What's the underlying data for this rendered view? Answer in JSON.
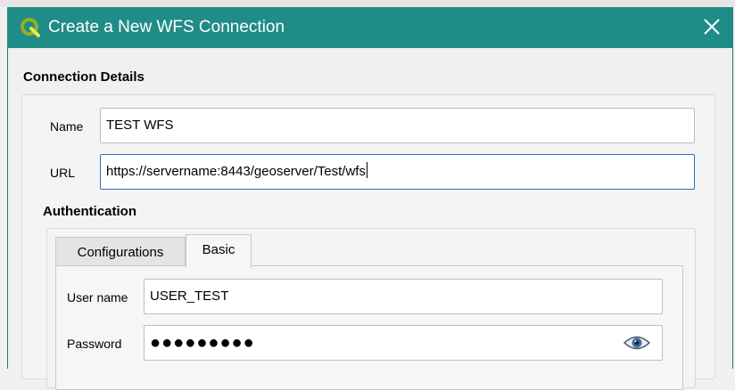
{
  "window": {
    "title": "Create a New WFS Connection",
    "app_icon": "qgis-logo-icon",
    "close_icon": "close-icon"
  },
  "connection_details": {
    "heading": "Connection Details",
    "name_label": "Name",
    "name_value": "TEST WFS",
    "url_label": "URL",
    "url_value": "https://servername:8443/geoserver/Test/wfs"
  },
  "authentication": {
    "heading": "Authentication",
    "tabs": [
      {
        "label": "Configurations",
        "active": false
      },
      {
        "label": "Basic",
        "active": true
      }
    ],
    "username_label": "User name",
    "username_value": "USER_TEST",
    "password_label": "Password",
    "password_masked": "●●●●●●●●●",
    "show_password_icon": "eye-icon"
  },
  "colors": {
    "titlebar": "#208c87",
    "focus_border": "#2c73b8"
  }
}
